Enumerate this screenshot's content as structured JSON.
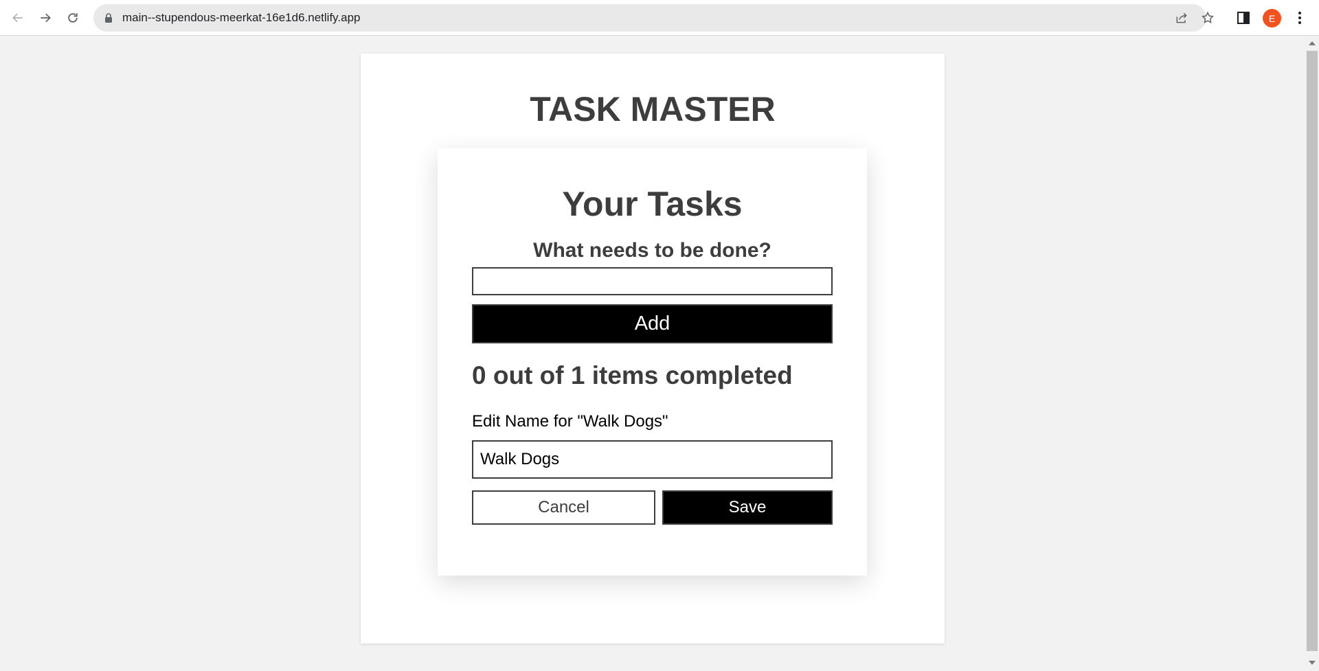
{
  "browser": {
    "url": "main--stupendous-meerkat-16e1d6.netlify.app",
    "profile_initial": "E",
    "profile_color": "#f4511e",
    "icons": [
      "back-icon",
      "forward-icon",
      "reload-icon",
      "lock-icon",
      "share-icon",
      "star-icon",
      "side-panel-icon",
      "menu-icon"
    ]
  },
  "app": {
    "title": "TASK MASTER"
  },
  "tasks": {
    "title": "Your Tasks",
    "prompt": "What needs to be done?",
    "new_task_value": "",
    "add_label": "Add",
    "status": "0 out of 1 items completed",
    "edit_label": "Edit Name for \"Walk Dogs\"",
    "edit_value": "Walk Dogs",
    "cancel_label": "Cancel",
    "save_label": "Save"
  },
  "colors": {
    "heading": "#3d3d3d",
    "primary_button": "#000000",
    "page_background": "#f2f2f2"
  }
}
